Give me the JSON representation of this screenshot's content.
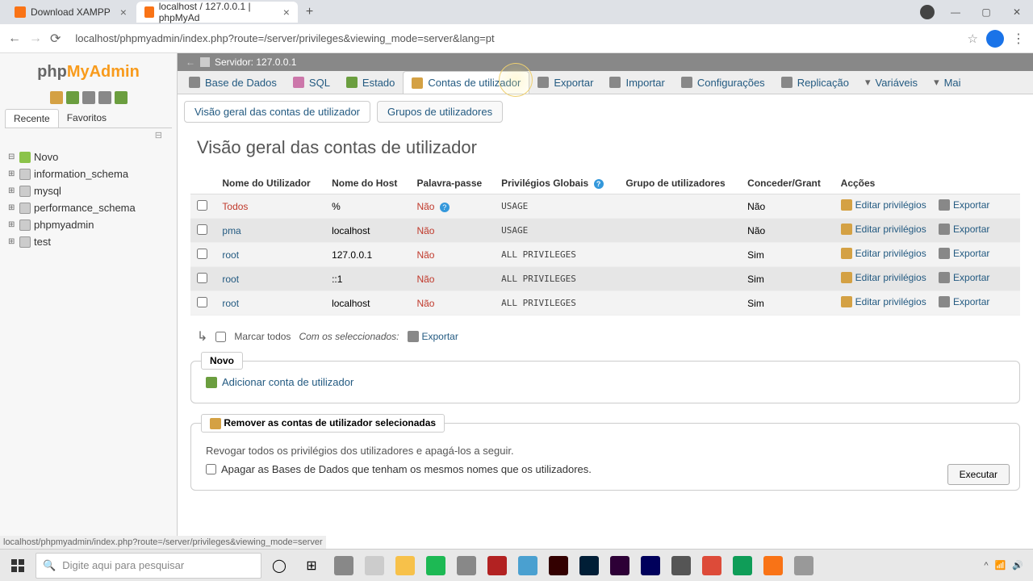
{
  "browser": {
    "tabs": [
      {
        "title": "Download XAMPP",
        "active": false
      },
      {
        "title": "localhost / 127.0.0.1 | phpMyAd",
        "active": true
      }
    ],
    "url": "localhost/phpmyadmin/index.php?route=/server/privileges&viewing_mode=server&lang=pt"
  },
  "sidebar": {
    "tabs": {
      "recent": "Recente",
      "favorites": "Favoritos"
    },
    "tree": [
      {
        "label": "Novo",
        "type": "new"
      },
      {
        "label": "information_schema",
        "type": "db"
      },
      {
        "label": "mysql",
        "type": "db"
      },
      {
        "label": "performance_schema",
        "type": "db"
      },
      {
        "label": "phpmyadmin",
        "type": "db"
      },
      {
        "label": "test",
        "type": "db"
      }
    ]
  },
  "server_bar": "Servidor: 127.0.0.1",
  "main_tabs": [
    "Base de Dados",
    "SQL",
    "Estado",
    "Contas de utilizador",
    "Exportar",
    "Importar",
    "Configurações",
    "Replicação",
    "Variáveis",
    "Mai"
  ],
  "sub_tabs": {
    "overview": "Visão geral das contas de utilizador",
    "groups": "Grupos de utilizadores"
  },
  "page_title": "Visão geral das contas de utilizador",
  "table": {
    "headers": {
      "username": "Nome do Utilizador",
      "host": "Nome do Host",
      "password": "Palavra-passe",
      "privileges": "Privilégios Globais",
      "group": "Grupo de utilizadores",
      "grant": "Conceder/Grant",
      "actions": "Acções"
    },
    "all_label": "Todos",
    "rows": [
      {
        "host": "%",
        "pass": "Não",
        "priv": "USAGE",
        "grant": "Não",
        "help": true
      },
      {
        "user": "pma",
        "host": "localhost",
        "pass": "Não",
        "priv": "USAGE",
        "grant": "Não"
      },
      {
        "user": "root",
        "host": "127.0.0.1",
        "pass": "Não",
        "priv": "ALL PRIVILEGES",
        "grant": "Sim"
      },
      {
        "user": "root",
        "host": "::1",
        "pass": "Não",
        "priv": "ALL PRIVILEGES",
        "grant": "Sim"
      },
      {
        "user": "root",
        "host": "localhost",
        "pass": "Não",
        "priv": "ALL PRIVILEGES",
        "grant": "Sim"
      }
    ],
    "action_edit": "Editar privilégios",
    "action_export": "Exportar"
  },
  "select_all": {
    "check_label": "Marcar todos",
    "with_selected": "Com os seleccionados:",
    "export": "Exportar"
  },
  "new_section": {
    "label": "Novo",
    "add_user": "Adicionar conta de utilizador"
  },
  "remove_section": {
    "label": "Remover as contas de utilizador selecionadas",
    "text": "Revogar todos os privilégios dos utilizadores e apagá-los a seguir.",
    "checkbox": "Apagar as Bases de Dados que tenham os mesmos nomes que os utilizadores."
  },
  "exec_button": "Executar",
  "status_url": "localhost/phpmyadmin/index.php?route=/server/privileges&viewing_mode=server",
  "search_placeholder": "Digite aqui para pesquisar",
  "taskbar_apps": [
    "#888",
    "#ccc",
    "#f7c14a",
    "#1db954",
    "#888",
    "#b22222",
    "#4aa0d0",
    "#330000",
    "#001e36",
    "#2d0036",
    "#00005b",
    "#555",
    "#dd4b39",
    "#0f9d58",
    "#f97316",
    "#999"
  ]
}
